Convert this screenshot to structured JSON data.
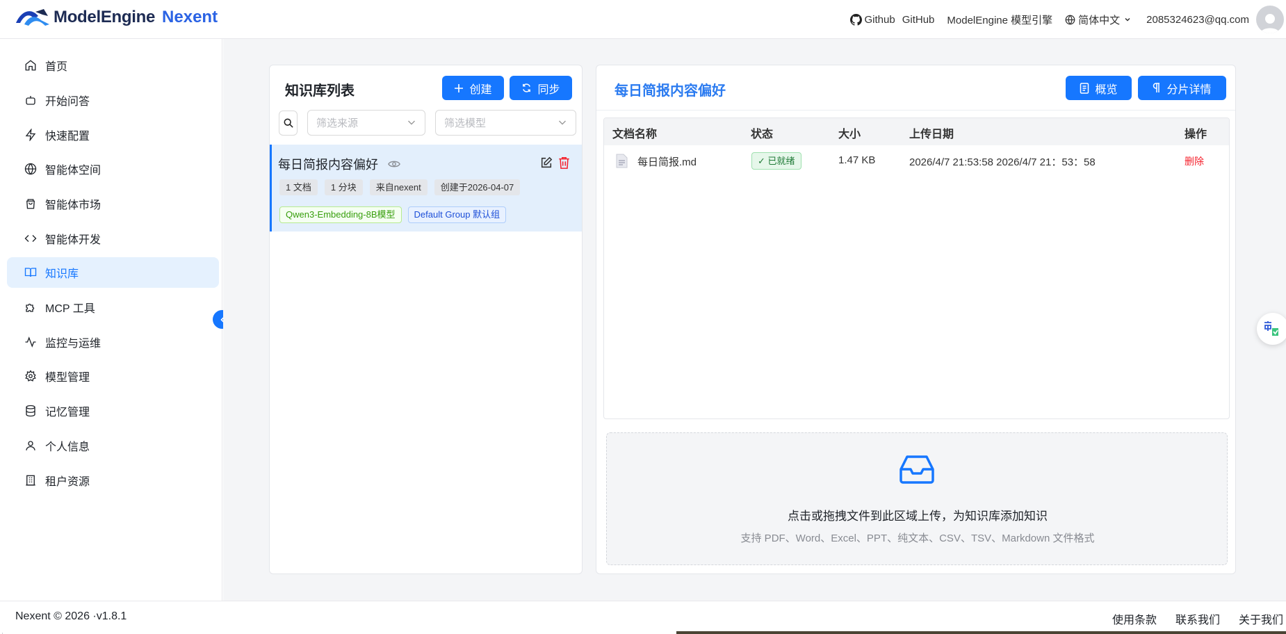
{
  "header": {
    "logo_text": "ModelEngine",
    "logo_text2": "Nexent",
    "github_label1": "Github",
    "github_label2": "GitHub",
    "modelengine_link": "ModelEngine 模型引擎",
    "language": "简体中文",
    "user_email": "2085324623@qq.com"
  },
  "sidebar": {
    "items": [
      {
        "label": "首页",
        "icon": "home-icon"
      },
      {
        "label": "开始问答",
        "icon": "robot-icon"
      },
      {
        "label": "快速配置",
        "icon": "lightning-icon"
      },
      {
        "label": "智能体空间",
        "icon": "globe-icon"
      },
      {
        "label": "智能体市场",
        "icon": "shopping-bag-icon"
      },
      {
        "label": "智能体开发",
        "icon": "code-icon"
      },
      {
        "label": "知识库",
        "icon": "book-icon",
        "active": true
      },
      {
        "label": "MCP 工具",
        "icon": "puzzle-icon"
      },
      {
        "label": "监控与运维",
        "icon": "activity-icon"
      },
      {
        "label": "模型管理",
        "icon": "gear-icon"
      },
      {
        "label": "记忆管理",
        "icon": "database-icon"
      },
      {
        "label": "个人信息",
        "icon": "user-icon"
      },
      {
        "label": "租户资源",
        "icon": "building-icon"
      }
    ]
  },
  "kb_list": {
    "title": "知识库列表",
    "create_label": "创建",
    "sync_label": "同步",
    "source_placeholder": "筛选来源",
    "model_placeholder": "筛选模型",
    "item": {
      "name": "每日简报内容偏好",
      "tags": [
        "1 文档",
        "1 分块",
        "来自nexent",
        "创建于2026-04-07"
      ],
      "model_tag": "Qwen3-Embedding-8B模型",
      "group_tag": "Default Group 默认组"
    }
  },
  "detail": {
    "title": "每日简报内容偏好",
    "overview_label": "概览",
    "chunks_label": "分片详情",
    "columns": [
      "文档名称",
      "状态",
      "大小",
      "上传日期",
      "操作"
    ],
    "rows": [
      {
        "name": "每日简报.md",
        "status": "✓ 已就绪",
        "size": "1.47 KB",
        "date": "2026/4/7 21:53:58 2026/4/7 21：53：58",
        "action": "删除"
      }
    ],
    "upload_main": "点击或拖拽文件到此区域上传，为知识库添加知识",
    "upload_sub": "支持 PDF、Word、Excel、PPT、纯文本、CSV、TSV、Markdown 文件格式"
  },
  "footer": {
    "copyright": "Nexent © 2026 ·v1.8.1",
    "links": [
      "使用条款",
      "联系我们",
      "关于我们"
    ]
  },
  "colors": {
    "accent": "#1677ff",
    "active_bg": "#e5f1fe",
    "danger": "#f5222d"
  }
}
